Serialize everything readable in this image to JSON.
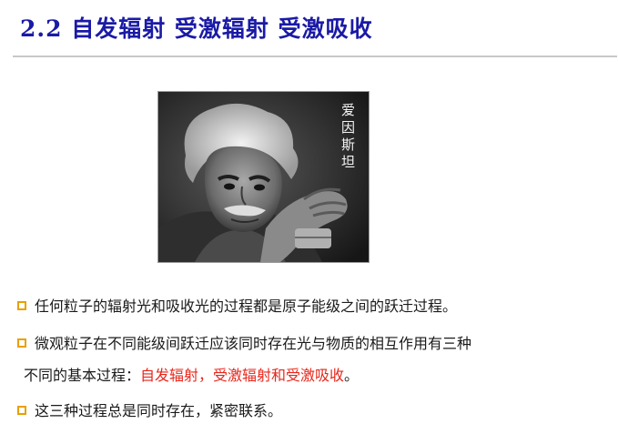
{
  "slide": {
    "title": "2.2 自发辐射 受激辐射 受激吸收",
    "photo_caption": "爱因斯坦",
    "bullets": [
      {
        "text": "任何粒子的辐射光和吸收光的过程都是原子能级之间的跃迁过程。"
      },
      {
        "text_line1": "微观粒子在不同能级间跃迁应该同时存在光与物质的相互作用有三种",
        "text_line2_prefix": "不同的基本过程：",
        "text_line2_highlight": "自发辐射，受激辐射和受激吸收",
        "text_line2_suffix": "。"
      },
      {
        "text": "这三种过程总是同时存在，紧密联系。"
      }
    ]
  },
  "colors": {
    "title": "#1a1aa6",
    "highlight": "#e8261a",
    "bullet_marker": "#e8a000",
    "rule": "#c8c8c8"
  }
}
